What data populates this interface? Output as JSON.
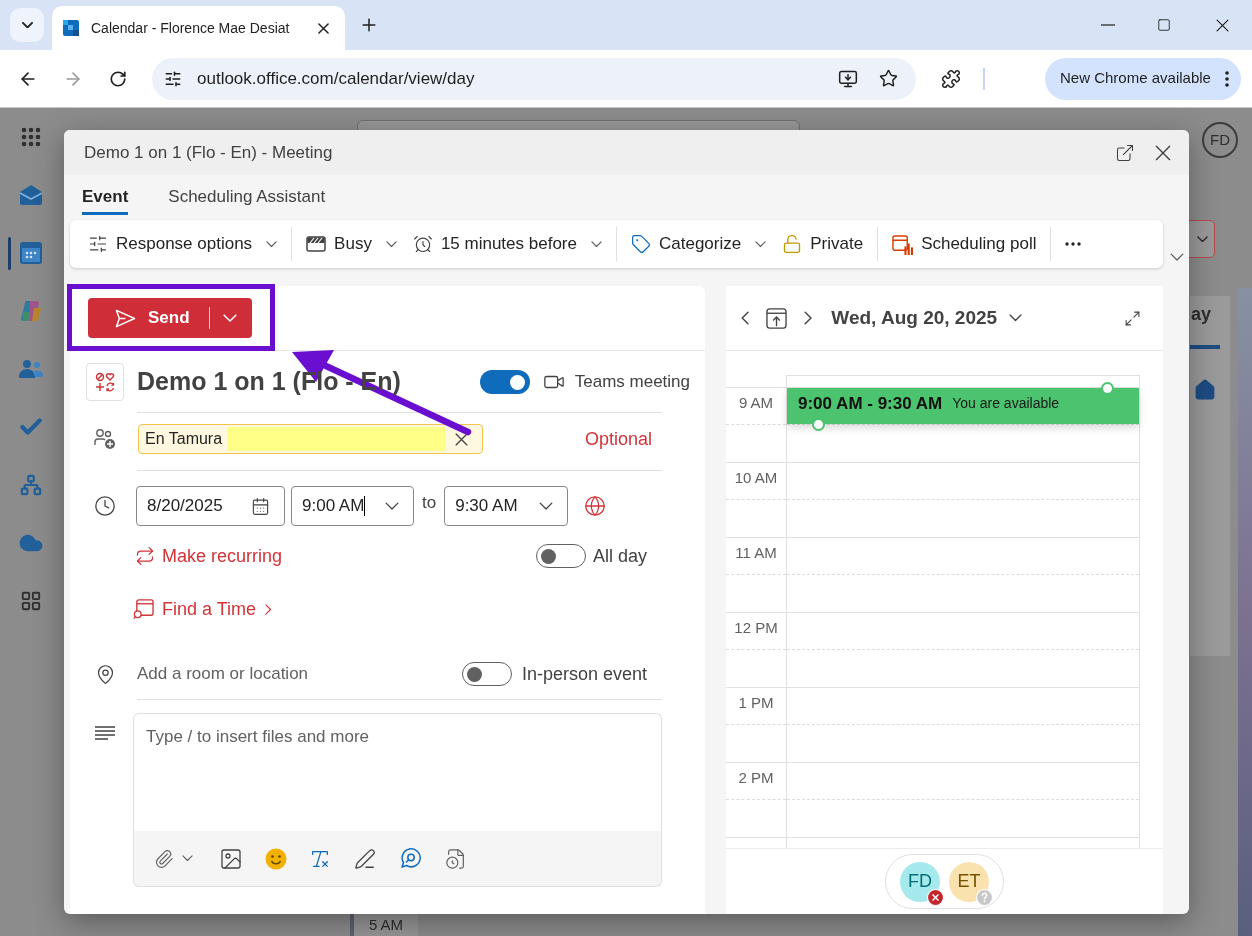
{
  "browser": {
    "tab_title": "Calendar - Florence Mae Desiat",
    "url": "outlook.office.com/calendar/view/day",
    "update_button": "New Chrome available"
  },
  "app_rail": [
    {
      "kind": "apps",
      "selected": false
    },
    {
      "kind": "mail",
      "selected": false
    },
    {
      "kind": "calendar",
      "selected": true
    },
    {
      "kind": "copilot",
      "selected": false
    },
    {
      "kind": "people",
      "selected": false
    },
    {
      "kind": "todo",
      "selected": false
    },
    {
      "kind": "org",
      "selected": false
    },
    {
      "kind": "onedrive",
      "selected": false
    },
    {
      "kind": "more_apps",
      "selected": false
    }
  ],
  "background": {
    "avatar": "FD",
    "view_tab": "ay",
    "time_label": "5 AM"
  },
  "dialog": {
    "title": "Demo 1 on 1 (Flo - En) - Meeting",
    "tabs": [
      {
        "label": "Event",
        "selected": true
      },
      {
        "label": "Scheduling Assistant",
        "selected": false
      }
    ],
    "toolbar": [
      {
        "items": [
          {
            "kind": "response",
            "label": "Response options",
            "dropdown": true
          }
        ]
      },
      {
        "items": [
          {
            "kind": "busy",
            "label": "Busy",
            "dropdown": true
          },
          {
            "kind": "reminder",
            "label": "15 minutes before",
            "dropdown": true
          }
        ]
      },
      {
        "items": [
          {
            "kind": "category",
            "label": "Categorize",
            "dropdown": true
          },
          {
            "kind": "private",
            "label": "Private",
            "dropdown": false
          }
        ]
      },
      {
        "items": [
          {
            "kind": "poll",
            "label": "Scheduling poll",
            "dropdown": false
          }
        ]
      },
      {
        "items": [
          {
            "kind": "more",
            "dropdown": false
          }
        ]
      }
    ],
    "send": {
      "label": "Send"
    },
    "event": {
      "title": "Demo 1 on 1 (Flo - En)",
      "teams": {
        "label": "Teams meeting",
        "on": true
      },
      "attendees": [
        {
          "name": "En Tamura"
        }
      ],
      "attendee_input_highlighted": true,
      "optional": "Optional",
      "date": "8/20/2025",
      "start": {
        "value": "9:00 AM",
        "focused": true
      },
      "to": "to",
      "end": {
        "value": "9:30 AM",
        "focused": false
      },
      "recurring": "Make recurring",
      "all_day": {
        "label": "All day",
        "on": false
      },
      "find_time": "Find a Time",
      "location": {
        "placeholder": "Add a room or location"
      },
      "in_person": {
        "label": "In-person event",
        "on": false
      },
      "body": {
        "placeholder": "Type / to insert files and more"
      }
    },
    "calendar": {
      "date": "Wed, Aug 20, 2025",
      "hours": [
        "9 AM",
        "10 AM",
        "11 AM",
        "12 PM",
        "1 PM",
        "2 PM"
      ],
      "event": {
        "time": "9:00 AM - 9:30 AM",
        "status": "You are available"
      },
      "attendees": [
        {
          "initials": "FD",
          "color": "#a6e9ed",
          "kind": "declined"
        },
        {
          "initials": "ET",
          "color": "#f9e2ae",
          "kind": "unknown"
        }
      ]
    }
  },
  "annotations": {
    "frame": true,
    "arrow": true
  }
}
